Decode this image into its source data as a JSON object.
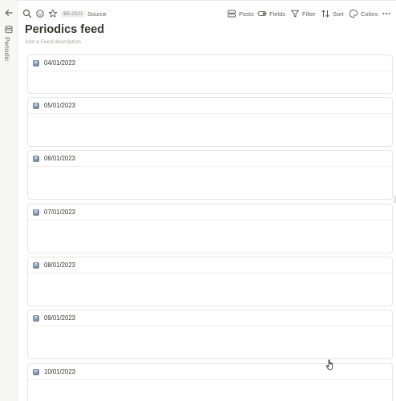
{
  "sidebar": {
    "label": "Periodic"
  },
  "toolbar": {
    "record_id": "$B-2021",
    "source_label": "Source",
    "posts_label": "Posts",
    "fields_label": "Fields",
    "filter_label": "Filter",
    "sort_label": "Sort",
    "colors_label": "Colors"
  },
  "page": {
    "title": "Periodics feed",
    "description_placeholder": "Add a Feed description"
  },
  "feed": {
    "badge_letter": "P",
    "items": [
      {
        "title": "04/01/2023"
      },
      {
        "title": "05/01/2023"
      },
      {
        "title": "06/01/2023"
      },
      {
        "title": "07/01/2023"
      },
      {
        "title": "08/01/2023"
      },
      {
        "title": "09/01/2023"
      },
      {
        "title": "10/01/2023"
      }
    ]
  },
  "colors": {
    "badge": "#7b8fa8",
    "text": "#37352f",
    "muted": "#a6a5a1"
  }
}
